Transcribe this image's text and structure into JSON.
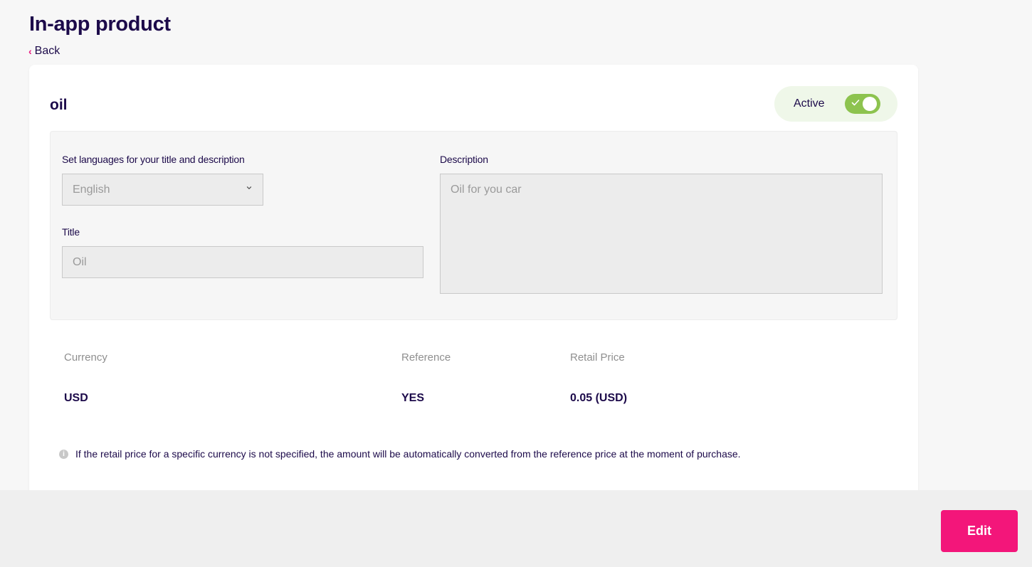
{
  "page": {
    "title": "In-app product",
    "back_label": "Back"
  },
  "product": {
    "name": "oil",
    "status_label": "Active",
    "status_on": true
  },
  "form": {
    "language_label": "Set languages for your title and description",
    "language_value": "English",
    "title_label": "Title",
    "title_value": "Oil",
    "description_label": "Description",
    "description_value": "Oil for you car"
  },
  "pricing": {
    "headers": [
      "Currency",
      "Reference",
      "Retail Price"
    ],
    "rows": [
      {
        "currency": "USD",
        "reference": "YES",
        "retail_price": "0.05 (USD)"
      }
    ],
    "note": "If the retail price for a specific currency is not specified, the amount will be automatically converted from the reference price at the moment of purchase."
  },
  "actions": {
    "edit_label": "Edit"
  },
  "colors": {
    "accent": "#f3167a",
    "toggle_on": "#8dc34f",
    "text_primary": "#1c0a4a"
  }
}
